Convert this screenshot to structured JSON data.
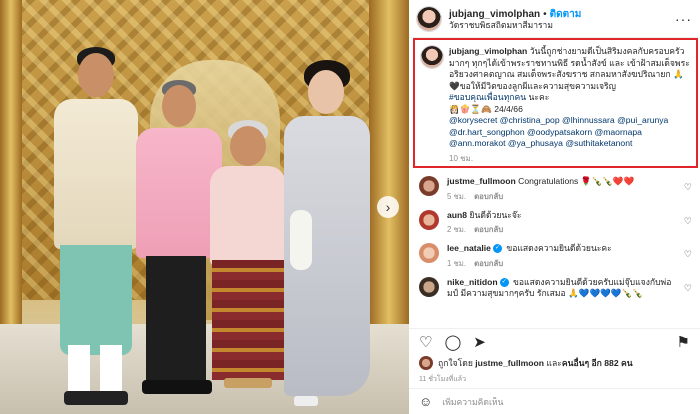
{
  "post": {
    "username": "jubjang_vimolphan",
    "follow_label": "ติดตาม",
    "location": "วัดราชบพิธสถิตมหาสีมาราม",
    "more_icon": "more-icon"
  },
  "caption": {
    "username": "jubjang_vimolphan",
    "text": "วันนี้ถูกช่างยามดีเป็นสิริมงคลกับครอบครัวมากๆ ทุกๆได้เข้าพระราชทานพิธี รดน้ำสังข์ และ เข้าฝ้าสมเด็จพระอริยวงศาคตญาณ สมเด็จพระสังฆราช สกลมหาสังฆปริณายก 🙏🖤ขอให้มีวิตของลูกผีและความสุขความเจริญ",
    "hashtag": "#ขอบคุณเพื่อนทุกคน",
    "hashtag_suffix": " นะคะ",
    "emoji_line": "👸🏻🍿⏳🙈 24/4/66",
    "tags": [
      "@korysecret",
      "@christina_pop",
      "@lhinnussara",
      "@pui_arunya",
      "@dr.hart_songphon",
      "@oodypatsakorn",
      "@maornapa",
      "@ann.morakot",
      "@ya_phusaya",
      "@suthitaketanont"
    ],
    "time": "10 ชม."
  },
  "comments": [
    {
      "username": "justme_fullmoon",
      "verified": false,
      "text": "Congratulations 🌹🍾🍾❤️❤️",
      "time": "5 ชม.",
      "reply": "ตอบกลับ",
      "color": "#a0522d"
    },
    {
      "username": "aun8",
      "verified": false,
      "text": "ยินดีด้วยนะจ๊ะ",
      "time": "2 ชม.",
      "reply": "ตอบกลับ",
      "color": "#c0392b"
    },
    {
      "username": "lee_natalie",
      "verified": true,
      "text": "ขอแสดงความยินดีด้วยนะคะ",
      "time": "1 ชม.",
      "reply": "ตอบกลับ",
      "color": "#d98e6b"
    },
    {
      "username": "nike_nitidon",
      "verified": true,
      "text": "ขอแสดงความยินดีด้วยครับแม่จุ๊บแจงกับพ่อมป์ มีความสุขมากๆครับ รักเสมอ 🙏💙💙💙💙🍾🍾",
      "time": "",
      "reply": "",
      "color": "#5a4a3a"
    }
  ],
  "actions": {
    "like_icon": "heart-icon",
    "comment_icon": "comment-icon",
    "share_icon": "share-icon",
    "save_icon": "bookmark-icon"
  },
  "likes": {
    "prefix": "ถูกใจโดย ",
    "user": "justme_fullmoon",
    "middle": " และ",
    "others": "คนอื่นๆ อีก 882 คน"
  },
  "date": "11 ชั่วโมงที่แล้ว",
  "add_comment": {
    "placeholder": "เพิ่มความคิดเห็น"
  }
}
